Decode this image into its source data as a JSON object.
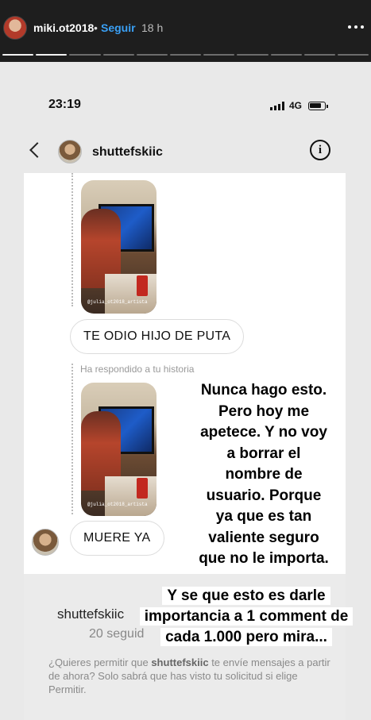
{
  "story": {
    "username": "miki.ot2018",
    "separator": "•",
    "follow_label": "Seguir",
    "time_ago": "18 h",
    "progress_total": 11,
    "progress_done": 2,
    "menu_icon": "more-horizontal-icon"
  },
  "status_bar": {
    "time": "23:19",
    "network": "4G"
  },
  "dm": {
    "username": "shuttefskiic",
    "back_icon": "chevron-left-icon",
    "info_icon": "info-icon",
    "info_glyph": "i"
  },
  "messages": [
    {
      "type": "story-reply",
      "text": "TE ODIO HIJO DE PUTA"
    },
    {
      "type": "story-reply",
      "text": "MUERE YA",
      "note": "Ha respondido a tu historia"
    }
  ],
  "thumb_tag": "@julia_ot2018_artista",
  "overlay": {
    "main": [
      "Nunca hago esto.",
      "Pero hoy me",
      "apetece. Y no voy",
      "a borrar el",
      "nombre de",
      "usuario. Porque",
      "ya que es tan",
      "valiente seguro",
      "que no le importa."
    ],
    "bottom": [
      "Y se que esto es darle",
      "importancia a 1 comment de",
      "cada 1.000 pero mira..."
    ]
  },
  "request": {
    "username": "shuttefskiic",
    "followers": "20 seguid",
    "text_before": "¿Quieres permitir que ",
    "text_user": "shuttefskiic",
    "text_after": " te envíe mensajes a partir de ahora? Solo sabrá que has visto tu solicitud si elige Permitir."
  }
}
